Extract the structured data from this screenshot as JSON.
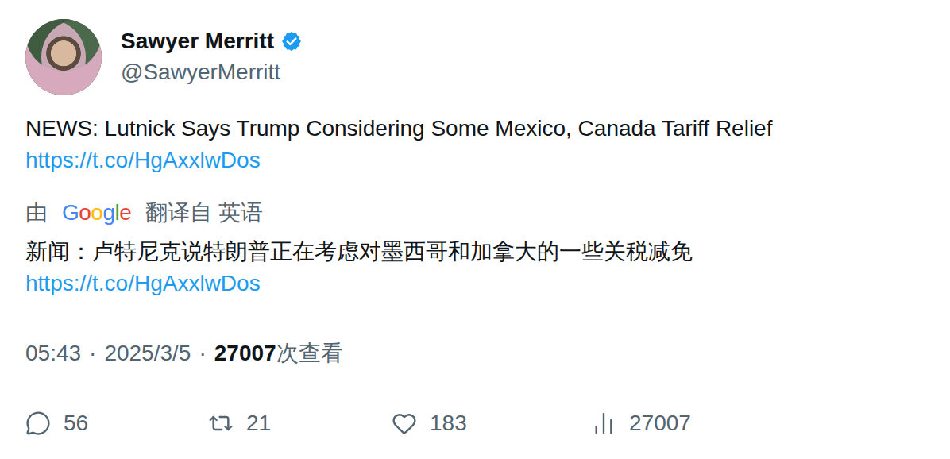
{
  "author": {
    "name": "Sawyer Merritt",
    "handle": "@SawyerMerritt",
    "verified": true
  },
  "tweet": {
    "text": "NEWS: Lutnick Says Trump Considering Some Mexico, Canada Tariff Relief",
    "link": "https://t.co/HgAxxlwDos"
  },
  "translation": {
    "prefix": "由",
    "provider": "Google",
    "suffix": "翻译自 英语",
    "text": "新闻：卢特尼克说特朗普正在考虑对墨西哥和加拿大的一些关税减免",
    "link": "https://t.co/HgAxxlwDos"
  },
  "meta": {
    "time": "05:43",
    "separator": "·",
    "date": "2025/3/5",
    "views": "27007",
    "views_label": "次查看"
  },
  "actions": [
    {
      "kind": "reply",
      "count": "56"
    },
    {
      "kind": "retweet",
      "count": "21"
    },
    {
      "kind": "like",
      "count": "183"
    },
    {
      "kind": "views",
      "count": "27007"
    }
  ]
}
